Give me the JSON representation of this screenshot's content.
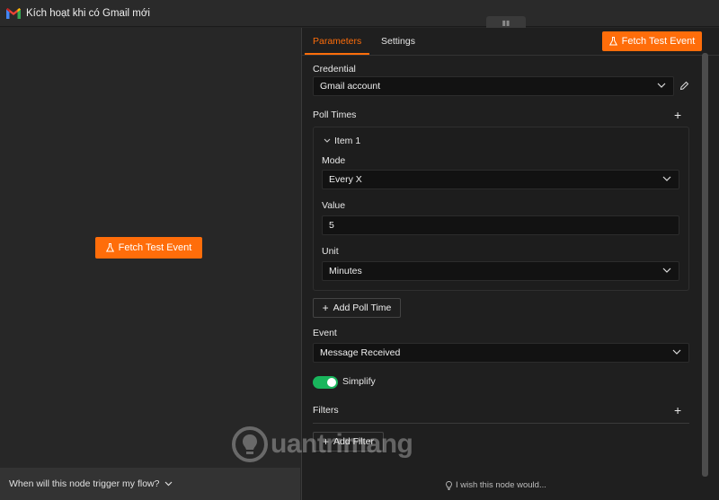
{
  "window": {
    "title": "Kích hoạt khi có Gmail mới"
  },
  "left_panel": {
    "fetch_button_label": "Fetch Test Event",
    "footer_question": "When will this node trigger my flow?"
  },
  "right_panel": {
    "tabs": [
      {
        "label": "Parameters"
      },
      {
        "label": "Settings"
      }
    ],
    "fetch_button_label": "Fetch Test Event",
    "credential": {
      "label": "Credential",
      "value": "Gmail account"
    },
    "poll_times": {
      "label": "Poll Times",
      "item_label": "Item 1",
      "mode": {
        "label": "Mode",
        "value": "Every X"
      },
      "value": {
        "label": "Value",
        "value": "5"
      },
      "unit": {
        "label": "Unit",
        "value": "Minutes"
      },
      "add_button_label": "Add Poll Time"
    },
    "event": {
      "label": "Event",
      "value": "Message Received"
    },
    "simplify": {
      "label": "Simplify"
    },
    "filters": {
      "label": "Filters",
      "add_button_label": "Add Filter"
    },
    "wish_text": "I wish this node would..."
  },
  "watermark_text": "uantrimang",
  "colors": {
    "accent": "#ff6d0a",
    "toggle_on": "#19b55c"
  }
}
